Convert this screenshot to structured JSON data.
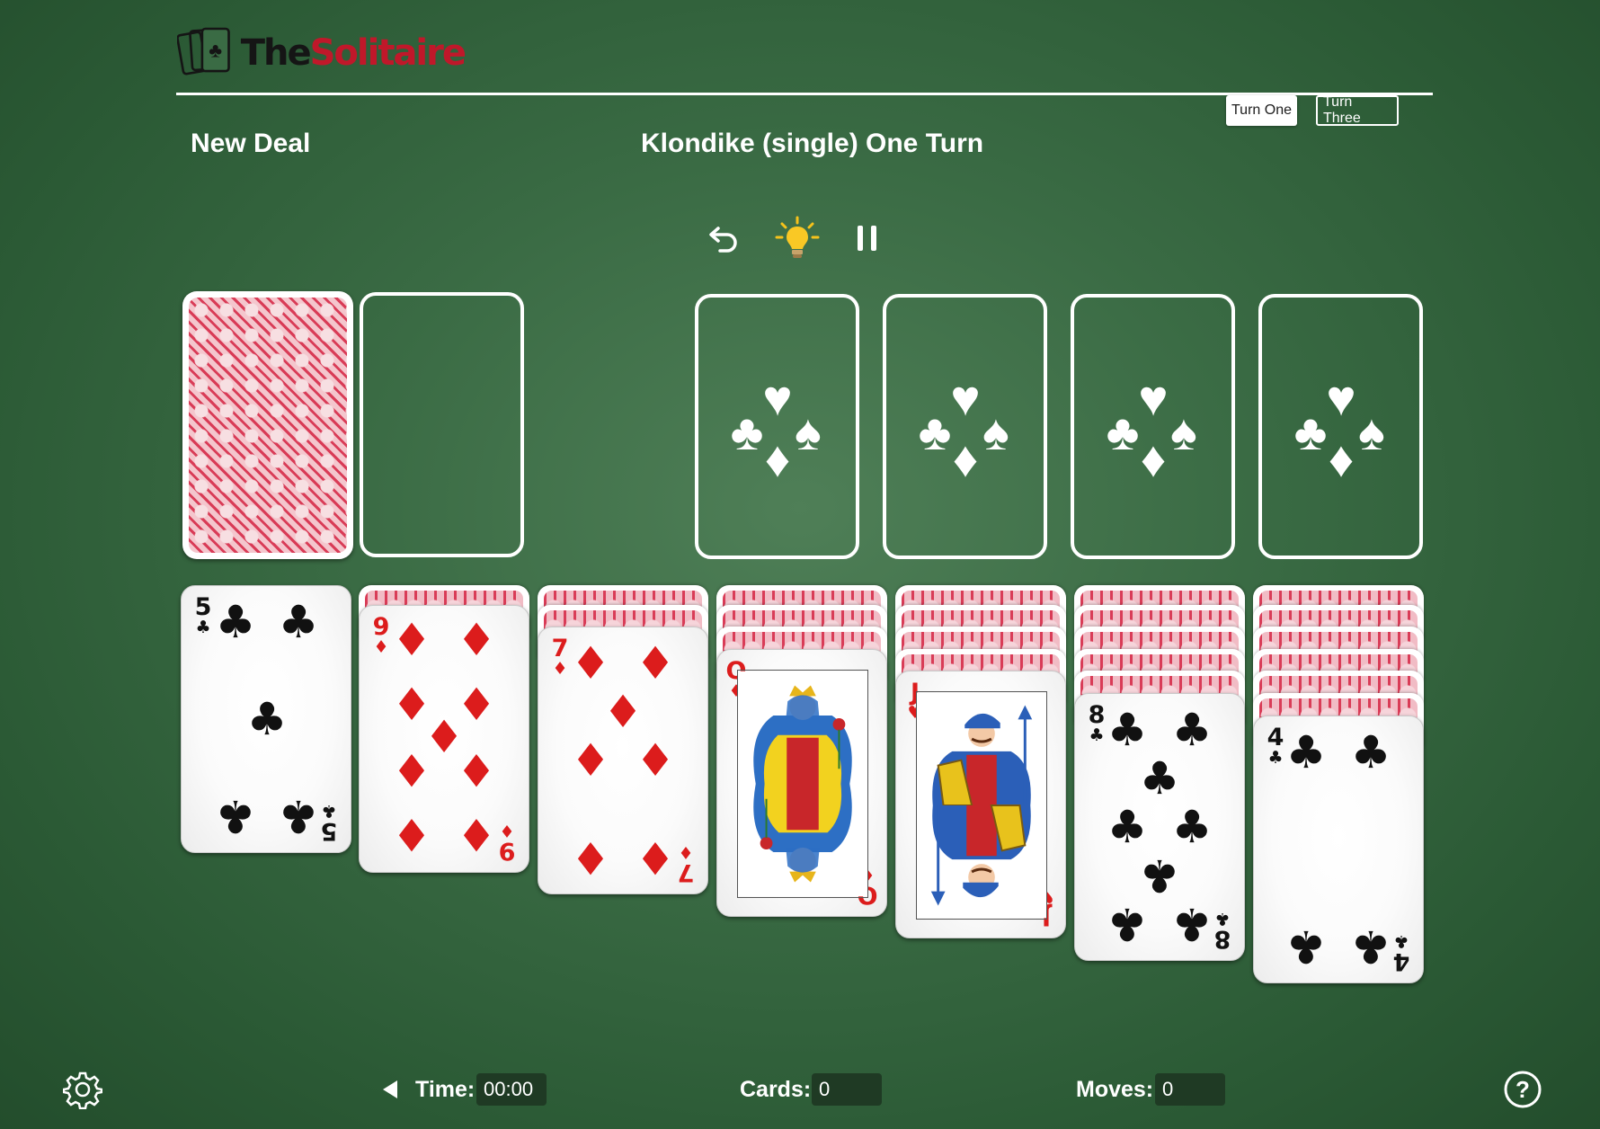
{
  "header": {
    "logo_the": "The",
    "logo_solitaire": "Solitaire",
    "turn_one_label": "Turn One",
    "turn_three_label": "Turn Three",
    "new_deal_label": "New Deal",
    "game_title": "Klondike (single) One Turn"
  },
  "toolbar": {
    "undo_icon": "undo-icon",
    "hint_icon": "lightbulb-icon",
    "pause_icon": "pause-icon"
  },
  "tableau": [
    {
      "rank": "5",
      "suit": "♣",
      "color": "black",
      "facedown": 0
    },
    {
      "rank": "9",
      "suit": "♦",
      "color": "red",
      "facedown": 1
    },
    {
      "rank": "7",
      "suit": "♦",
      "color": "red",
      "facedown": 2
    },
    {
      "rank": "Q",
      "suit": "♦",
      "color": "red",
      "facedown": 3
    },
    {
      "rank": "J",
      "suit": "♥",
      "color": "red",
      "facedown": 4
    },
    {
      "rank": "8",
      "suit": "♣",
      "color": "black",
      "facedown": 5
    },
    {
      "rank": "4",
      "suit": "♣",
      "color": "black",
      "facedown": 6
    }
  ],
  "status": {
    "time_label": "Time:",
    "time_value": "00:00",
    "cards_label": "Cards:",
    "cards_value": "0",
    "moves_label": "Moves:",
    "moves_value": "0"
  },
  "colors": {
    "felt": "#3a6b44",
    "red_suit": "#dc1c1c",
    "logo_red": "#c0182a"
  }
}
